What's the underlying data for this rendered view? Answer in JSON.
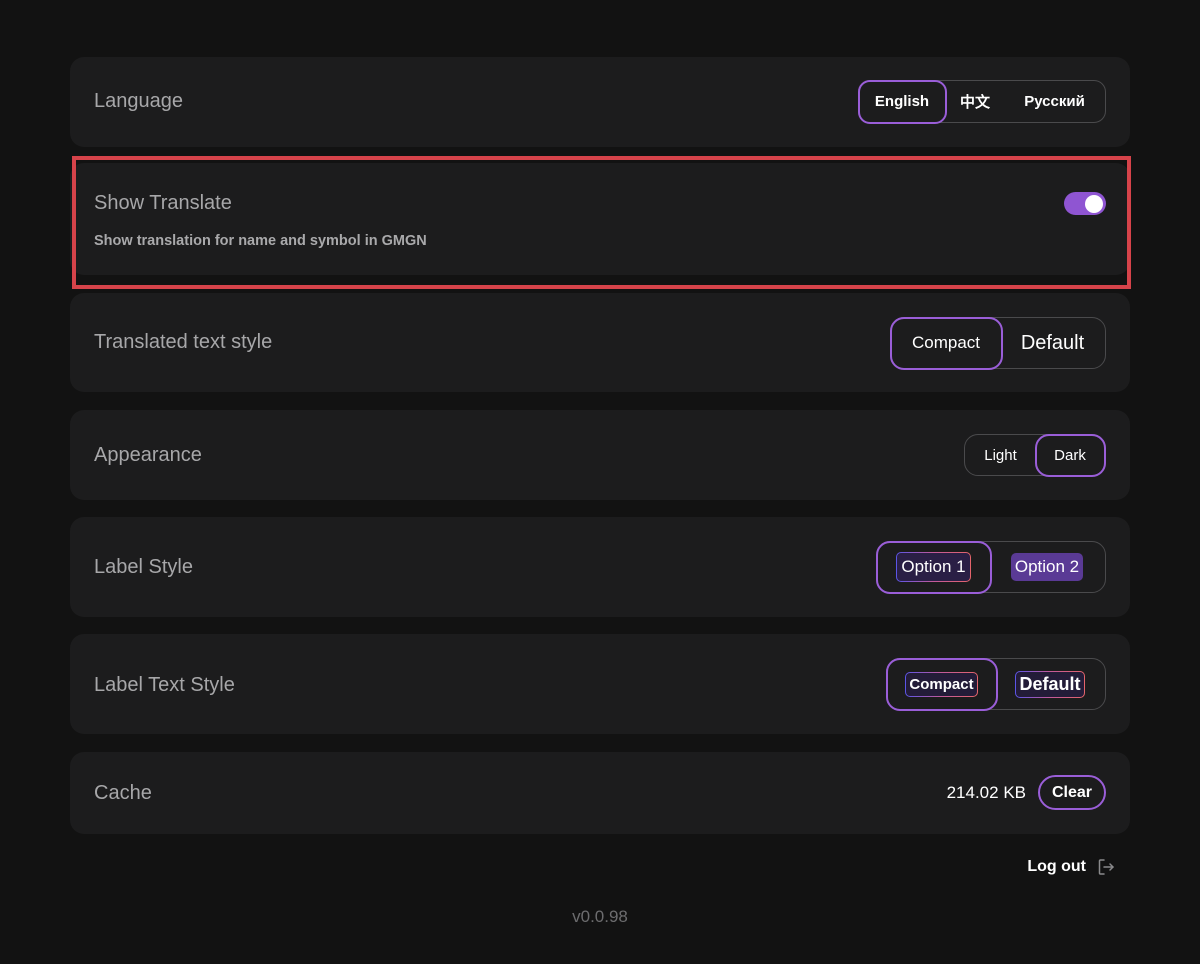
{
  "settings": {
    "language": {
      "title": "Language",
      "options": [
        "English",
        "中文",
        "Русский"
      ],
      "selected": "English"
    },
    "show_translate": {
      "title": "Show Translate",
      "description": "Show translation for name and symbol in GMGN",
      "enabled": true
    },
    "translated_text_style": {
      "title": "Translated text style",
      "options": [
        "Compact",
        "Default"
      ],
      "selected": "Compact"
    },
    "appearance": {
      "title": "Appearance",
      "options": [
        "Light",
        "Dark"
      ],
      "selected": "Dark"
    },
    "label_style": {
      "title": "Label Style",
      "options": [
        "Option 1",
        "Option 2"
      ],
      "selected": "Option 1"
    },
    "label_text_style": {
      "title": "Label Text Style",
      "options": [
        "Compact",
        "Default"
      ],
      "selected": "Compact"
    },
    "cache": {
      "title": "Cache",
      "size": "214.02 KB",
      "clear_label": "Clear"
    }
  },
  "footer": {
    "logout_label": "Log out",
    "logout_icon": "logout-arrow-icon",
    "version": "v0.0.98"
  },
  "colors": {
    "background": "#121212",
    "card": "#1c1c1d",
    "accent": "#9a5ed8",
    "toggle_on": "#8f55d2",
    "highlight": "#d6434a"
  }
}
